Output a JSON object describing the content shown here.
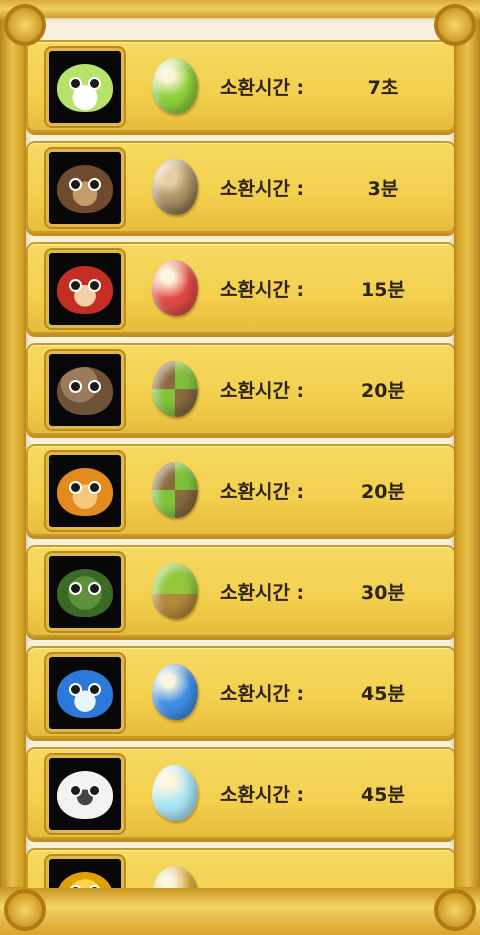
{
  "summon_list": {
    "label": "소환시간 :",
    "items": [
      {
        "creature": "green-sprout-creature",
        "gem_color": "#8fd13a",
        "gem_style": "green",
        "time": "7초"
      },
      {
        "creature": "brown-dog-creature",
        "gem_color": "#b59a6d",
        "gem_style": "brown",
        "time": "3분"
      },
      {
        "creature": "red-tanuki-creature",
        "gem_color": "#e24a45",
        "gem_style": "red",
        "time": "15분"
      },
      {
        "creature": "brown-mole-creature",
        "gem_color": "#9db348",
        "gem_style": "green-brown-check",
        "time": "20분"
      },
      {
        "creature": "orange-duck-creature",
        "gem_color": "#9db348",
        "gem_style": "green-brown-check",
        "time": "20분"
      },
      {
        "creature": "green-turtle-creature",
        "gem_color": "#92c83a",
        "gem_style": "green-brown-split",
        "time": "30분"
      },
      {
        "creature": "blue-seal-creature",
        "gem_color": "#3f8fe6",
        "gem_style": "blue",
        "time": "45분"
      },
      {
        "creature": "white-yeti-creature",
        "gem_color": "#a9e6f8",
        "gem_style": "lightblue",
        "time": "45분"
      },
      {
        "creature": "yellow-lightning-creature",
        "gem_color": "#d7a639",
        "gem_style": "gold",
        "time": ""
      }
    ]
  }
}
